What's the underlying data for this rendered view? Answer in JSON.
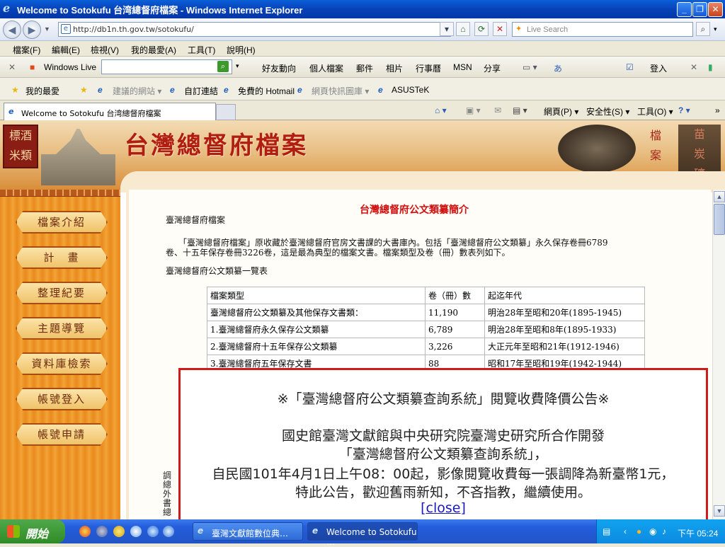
{
  "window": {
    "title": "Welcome to Sotokufu 台湾總督府檔案 - Windows Internet Explorer"
  },
  "address": {
    "url": "http://db1n.th.gov.tw/sotokufu/",
    "search_placeholder": "Live Search"
  },
  "menu": [
    "檔案(F)",
    "編輯(E)",
    "檢視(V)",
    "我的最愛(A)",
    "工具(T)",
    "說明(H)"
  ],
  "live_toolbar": {
    "brand": "Windows Live",
    "items": [
      "好友動向",
      "個人檔案",
      "郵件",
      "相片",
      "行事曆",
      "MSN",
      "分享"
    ],
    "signin": "登入"
  },
  "favorites": {
    "label": "我的最愛",
    "items": [
      "建議的網站 ▾",
      "自訂連結",
      "免費的 Hotmail",
      "網頁快訊圖庫 ▾",
      "ASUSTeK"
    ]
  },
  "tab": {
    "title": "Welcome to Sotokufu 台湾總督府檔案",
    "tools": [
      "網頁(P) ▾",
      "安全性(S) ▾",
      "工具(O) ▾"
    ]
  },
  "site": {
    "logo": "台灣總督府檔案",
    "seal_text": "檔案",
    "nav": [
      "檔案介紹",
      "計　畫",
      "整理紀要",
      "主題導覽",
      "資料庫檢索",
      "帳號登入",
      "帳號申請"
    ]
  },
  "article": {
    "title": "台灣總督府公文類纂簡介",
    "subtitle": "臺灣總督府檔案",
    "para_line1": "　　「臺灣總督府檔案」原收藏於臺灣總督府官房文書課的大書庫內。包括「臺灣總督府公文類纂」永久保存卷冊6789",
    "para_line2": "卷、十五年保存卷冊3226卷，這是最為典型的檔案文書。檔案類型及卷（冊）數表列如下。",
    "list_heading": "臺灣總督府公文類纂一覽表",
    "table": {
      "headers": [
        "檔案類型",
        "卷（冊）數",
        "起迄年代"
      ],
      "rows": [
        [
          "臺灣總督府公文類纂及其他保存文書類：",
          "11,190",
          "明治28年至昭和20年(1895-1945)"
        ],
        [
          "1.臺灣總督府永久保存公文類纂",
          "6,789",
          "明治28年至昭和8年(1895-1933)"
        ],
        [
          "2.臺灣總督府十五年保存公文類纂",
          "3,226",
          "大正元年至昭和21年(1912-1946)"
        ],
        [
          "3.臺灣總督府五年保存文書",
          "88",
          "昭和17年至昭和19年(1942-1944)"
        ]
      ]
    },
    "leftover_chars": [
      "調",
      "總",
      "外",
      "書",
      "總"
    ]
  },
  "popup": {
    "heading": "※「臺灣總督府公文類纂查詢系統」閱覽收費降價公告※",
    "line1": "國史館臺灣文獻館與中央研究院臺灣史研究所合作開發",
    "line2": "「臺灣總督府公文類纂查詢系統」，",
    "line3": "自民國101年4月1日上午08：00起，影像閱覽收費每一張調降為新臺幣1元，",
    "line4": "特此公告，歡迎舊雨新知，不吝指教，繼續使用。",
    "close": "[close]"
  },
  "taskbar": {
    "start": "開始",
    "items": [
      "臺灣文獻館數位典…",
      "Welcome to Sotokufu …"
    ],
    "clock": "下午 05:24"
  }
}
